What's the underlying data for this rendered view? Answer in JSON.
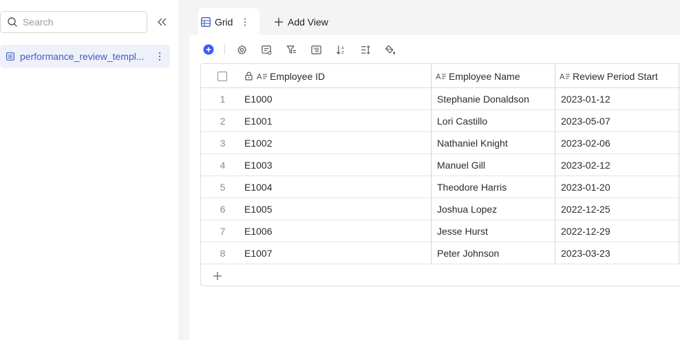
{
  "sidebar": {
    "search": {
      "placeholder": "Search",
      "value": ""
    },
    "tables": [
      {
        "label": "performance_review_templ...",
        "icon": "table-icon"
      }
    ]
  },
  "tabs": {
    "active": {
      "label": "Grid",
      "icon": "grid-icon"
    },
    "add_view_label": "Add View"
  },
  "toolbar": {
    "accent": "#3d5bf2",
    "buttons": [
      "add-record-icon",
      "settings-icon",
      "field-manage-icon",
      "filter-icon",
      "group-icon",
      "sort-icon",
      "row-height-icon",
      "color-fill-icon"
    ]
  },
  "grid": {
    "columns": [
      {
        "label": "Employee ID",
        "icon": "text-field-icon",
        "locked": true
      },
      {
        "label": "Employee Name",
        "icon": "text-field-icon"
      },
      {
        "label": "Review Period Start",
        "icon": "text-field-icon"
      }
    ],
    "rows": [
      {
        "num": "1",
        "id": "E1000",
        "name": "Stephanie Donaldson",
        "start": "2023-01-12"
      },
      {
        "num": "2",
        "id": "E1001",
        "name": "Lori Castillo",
        "start": "2023-05-07"
      },
      {
        "num": "3",
        "id": "E1002",
        "name": "Nathaniel Knight",
        "start": "2023-02-06"
      },
      {
        "num": "4",
        "id": "E1003",
        "name": "Manuel Gill",
        "start": "2023-02-12"
      },
      {
        "num": "5",
        "id": "E1004",
        "name": "Theodore Harris",
        "start": "2023-01-20"
      },
      {
        "num": "6",
        "id": "E1005",
        "name": "Joshua Lopez",
        "start": "2022-12-25"
      },
      {
        "num": "7",
        "id": "E1006",
        "name": "Jesse Hurst",
        "start": "2022-12-29"
      },
      {
        "num": "8",
        "id": "E1007",
        "name": "Peter Johnson",
        "start": "2023-03-23"
      }
    ]
  }
}
